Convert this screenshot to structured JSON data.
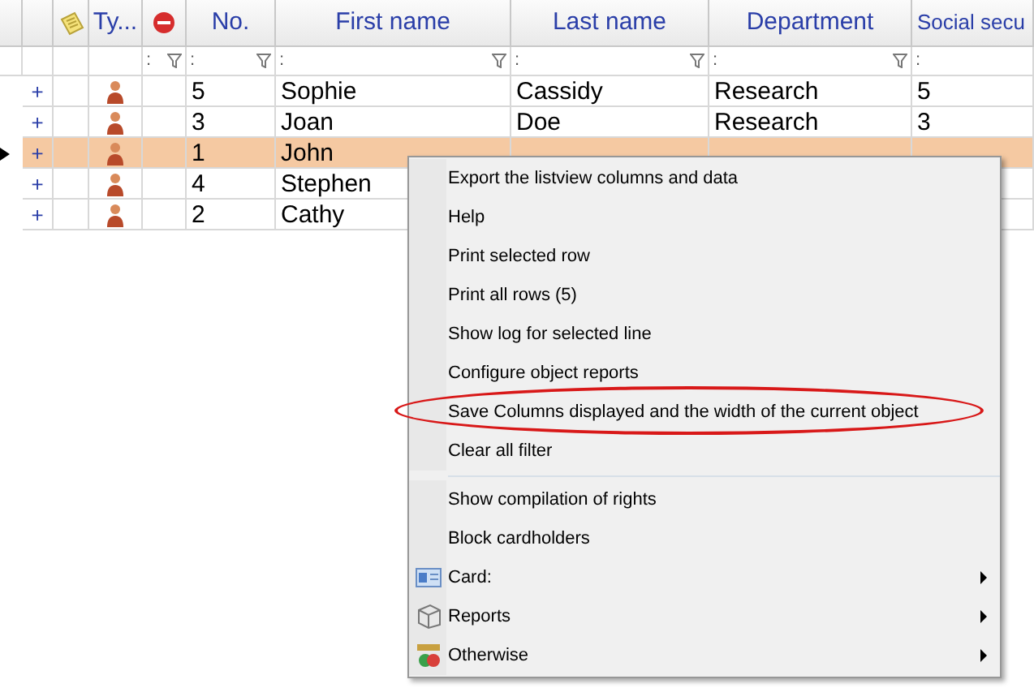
{
  "columns": [
    {
      "kind": "blank"
    },
    {
      "kind": "blank"
    },
    {
      "kind": "note_icon"
    },
    {
      "kind": "text",
      "label": "Ty..."
    },
    {
      "kind": "stop_icon"
    },
    {
      "kind": "text",
      "label": "No."
    },
    {
      "kind": "text",
      "label": "First name"
    },
    {
      "kind": "text",
      "label": "Last name"
    },
    {
      "kind": "text",
      "label": "Department"
    },
    {
      "kind": "text",
      "label": "Social secu"
    }
  ],
  "filter_row": [
    {
      "kind": "empty"
    },
    {
      "kind": "empty"
    },
    {
      "kind": "empty"
    },
    {
      "kind": "empty"
    },
    {
      "kind": "filter",
      "text": ":",
      "funnel": true
    },
    {
      "kind": "filter",
      "text": ":",
      "funnel": true
    },
    {
      "kind": "filter",
      "text": ":",
      "funnel": true
    },
    {
      "kind": "filter",
      "text": ":",
      "funnel": true
    },
    {
      "kind": "filter",
      "text": ":",
      "funnel": true
    },
    {
      "kind": "filter",
      "text": ":",
      "funnel": false
    }
  ],
  "rows": [
    {
      "expand": "+",
      "selected": false,
      "no": "5",
      "first_name": "Sophie",
      "last_name": "Cassidy",
      "department": "Research",
      "social": "5"
    },
    {
      "expand": "+",
      "selected": false,
      "no": "3",
      "first_name": "Joan",
      "last_name": "Doe",
      "department": "Research",
      "social": "3"
    },
    {
      "expand": "+",
      "selected": true,
      "no": "1",
      "first_name": "John"
    },
    {
      "expand": "+",
      "selected": false,
      "no": "4",
      "first_name": "Stephen"
    },
    {
      "expand": "+",
      "selected": false,
      "no": "2",
      "first_name": "Cathy"
    }
  ],
  "context_menu": [
    {
      "kind": "item",
      "label": "Export the listview columns and data",
      "circled": false
    },
    {
      "kind": "item",
      "label": "Help",
      "circled": false
    },
    {
      "kind": "item",
      "label": "Print selected row",
      "circled": false
    },
    {
      "kind": "item",
      "label": "Print all rows (5)",
      "circled": false
    },
    {
      "kind": "item",
      "label": "Show log for selected line",
      "circled": false
    },
    {
      "kind": "item",
      "label": "Configure object reports",
      "circled": false
    },
    {
      "kind": "item",
      "label": "Save Columns displayed and the width of the current object",
      "circled": true
    },
    {
      "kind": "item",
      "label": "Clear all filter",
      "circled": false
    },
    {
      "kind": "separator"
    },
    {
      "kind": "item",
      "label": "Show compilation of rights",
      "circled": false
    },
    {
      "kind": "item",
      "label": "Block cardholders",
      "circled": false
    },
    {
      "kind": "submenu",
      "label": "Card:",
      "circled": false
    },
    {
      "kind": "submenu",
      "label": "Reports",
      "circled": false
    },
    {
      "kind": "submenu",
      "label": "Otherwise",
      "circled": false
    }
  ]
}
